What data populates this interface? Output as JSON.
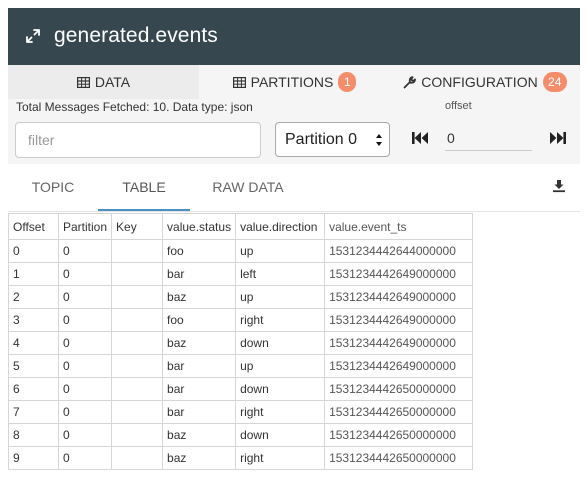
{
  "header": {
    "title": "generated.events"
  },
  "main_tabs": [
    {
      "label": "DATA"
    },
    {
      "label": "PARTITIONS",
      "badge": "1"
    },
    {
      "label": "CONFIGURATION",
      "badge": "24"
    }
  ],
  "panel": {
    "meta": "Total Messages Fetched: 10. Data type: json",
    "filter_placeholder": "filter",
    "partition_value": "Partition 0",
    "seek_label": "offset",
    "offset_value": "0"
  },
  "sub_tabs": [
    {
      "label": "TOPIC"
    },
    {
      "label": "TABLE"
    },
    {
      "label": "RAW DATA"
    }
  ],
  "table": {
    "columns": [
      "Offset",
      "Partition",
      "Key",
      "value.status",
      "value.direction",
      "value.event_ts"
    ],
    "rows": [
      [
        "0",
        "0",
        "",
        "foo",
        "up",
        "1531234442644000000"
      ],
      [
        "1",
        "0",
        "",
        "bar",
        "left",
        "1531234442649000000"
      ],
      [
        "2",
        "0",
        "",
        "baz",
        "up",
        "1531234442649000000"
      ],
      [
        "3",
        "0",
        "",
        "foo",
        "right",
        "1531234442649000000"
      ],
      [
        "4",
        "0",
        "",
        "baz",
        "down",
        "1531234442649000000"
      ],
      [
        "5",
        "0",
        "",
        "bar",
        "up",
        "1531234442649000000"
      ],
      [
        "6",
        "0",
        "",
        "bar",
        "down",
        "1531234442650000000"
      ],
      [
        "7",
        "0",
        "",
        "bar",
        "right",
        "1531234442650000000"
      ],
      [
        "8",
        "0",
        "",
        "baz",
        "down",
        "1531234442650000000"
      ],
      [
        "9",
        "0",
        "",
        "baz",
        "right",
        "1531234442650000000"
      ]
    ]
  },
  "colors": {
    "header_bg": "#37474f",
    "badge": "#f58d6a",
    "active_tab_underline": "#4a90c2"
  },
  "icons": {
    "header": "expand-icon",
    "data_tab": "table-icon",
    "partitions_tab": "table-icon",
    "config_tab": "wrench-icon",
    "first": "skip-first-icon",
    "last": "skip-last-icon",
    "download": "download-icon"
  }
}
